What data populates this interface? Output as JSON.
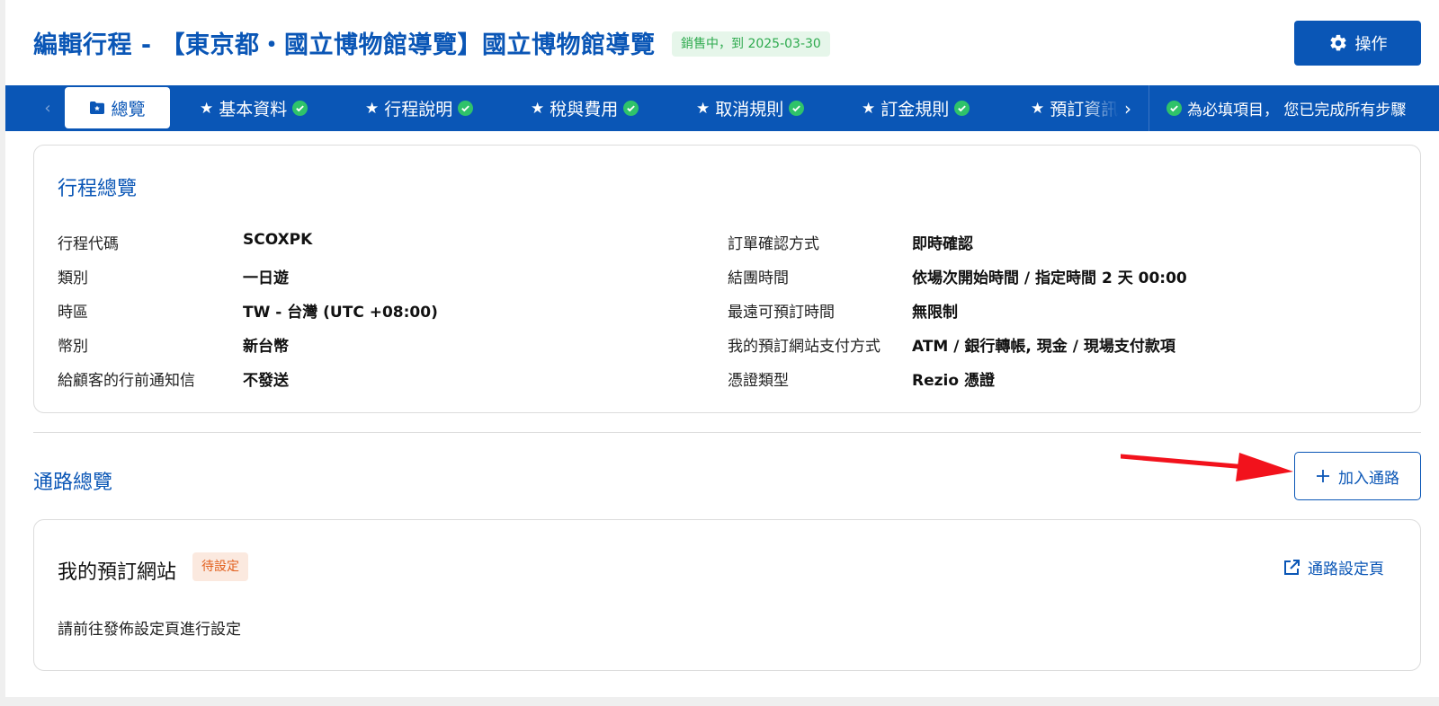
{
  "header": {
    "title": "編輯行程 - 【東京都・國立博物館導覽】國立博物館導覽",
    "status_badge": "銷售中，到 2025-03-30",
    "action_label": "操作"
  },
  "tabs": {
    "prev_glyph": "‹",
    "next_glyph": "›",
    "active": {
      "label": "總覽",
      "icon": "folder-star-icon"
    },
    "items": [
      {
        "label": "基本資料",
        "complete": true
      },
      {
        "label": "行程說明",
        "complete": true
      },
      {
        "label": "稅與費用",
        "complete": true
      },
      {
        "label": "取消規則",
        "complete": true
      },
      {
        "label": "訂金規則",
        "complete": true
      },
      {
        "label": "預訂資訊",
        "complete": true
      }
    ],
    "star_glyph": "★",
    "completion_note": "為必填項目， 您已完成所有步驟"
  },
  "overview": {
    "title": "行程總覽",
    "left": [
      {
        "label": "行程代碼",
        "value": "SCOXPK"
      },
      {
        "label": "類別",
        "value": "一日遊"
      },
      {
        "label": "時區",
        "value": "TW - 台灣 (UTC +08:00)"
      },
      {
        "label": "幣別",
        "value": "新台幣"
      },
      {
        "label": "給顧客的行前通知信",
        "value": "不發送"
      }
    ],
    "right": [
      {
        "label": "訂單確認方式",
        "value": "即時確認"
      },
      {
        "label": "結團時間",
        "value": "依場次開始時間 / 指定時間 2 天 00:00"
      },
      {
        "label": "最遠可預訂時間",
        "value": "無限制"
      },
      {
        "label": "我的預訂網站支付方式",
        "value": "ATM / 銀行轉帳, 現金 / 現場支付款項"
      },
      {
        "label": "憑證類型",
        "value": "Rezio 憑證"
      }
    ]
  },
  "channels": {
    "title": "通路總覽",
    "add_label": "加入通路",
    "card": {
      "name": "我的預訂網站",
      "badge": "待設定",
      "settings_link": "通路設定頁",
      "hint": "請前往發佈設定頁進行設定"
    }
  },
  "colors": {
    "brand": "#0a56b6",
    "success": "#2fc36a",
    "warning_text": "#e2601e",
    "annotation_arrow": "#f2121c"
  }
}
